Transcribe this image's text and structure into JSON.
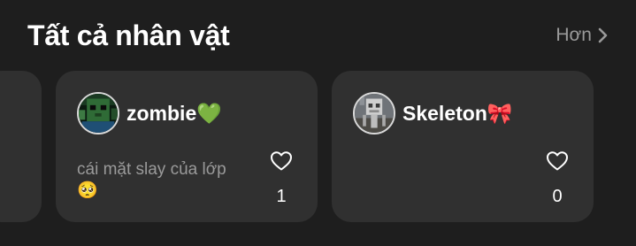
{
  "section": {
    "title": "Tất cả nhân vật",
    "more_label": "Hơn"
  },
  "cards": [
    {
      "name": "zombie💚",
      "description": "cái mặt slay của lớp 🥺",
      "likes": "1",
      "avatar": "zombie-avatar"
    },
    {
      "name": "Skeleton🎀",
      "description": "",
      "likes": "0",
      "avatar": "skeleton-avatar"
    }
  ],
  "colors": {
    "background": "#1e1e1e",
    "card": "#303030",
    "muted_text": "#9a9a9a"
  }
}
